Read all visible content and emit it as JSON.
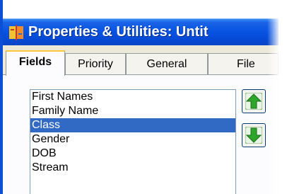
{
  "window": {
    "title": "Properties & Utilities: Untit"
  },
  "tabs": [
    {
      "label": "Fields",
      "active": true
    },
    {
      "label": "Priority",
      "active": false
    },
    {
      "label": "General",
      "active": false
    },
    {
      "label": "File",
      "active": false
    }
  ],
  "fields_list": {
    "items": [
      "First Names",
      "Family Name",
      "Class",
      "Gender",
      "DOB",
      "Stream"
    ],
    "selected": "Class"
  },
  "buttons": {
    "move_up_icon": "green-up-arrow-icon",
    "move_down_icon": "green-down-arrow-icon"
  },
  "colors": {
    "titlebar": "#0854e3",
    "selection": "#316ac5",
    "active_tab_highlight": "#ffc83c",
    "arrow_green": "#2fa52b"
  }
}
